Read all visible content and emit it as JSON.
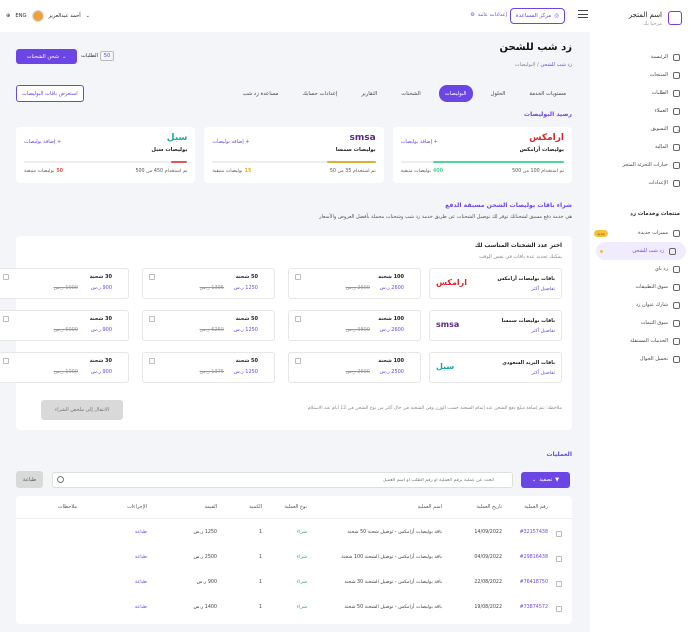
{
  "app": {
    "store_name": "اسم المتجر",
    "store_sub": "مرحبا بك",
    "help_label": "مركز المساعدة",
    "settings_label": "إعدادات عامة",
    "user_name": "أحمد عبدالعزيز",
    "lang": "ENG"
  },
  "sidebar": {
    "items": [
      {
        "label": "الرئيسية",
        "icon": "home-icon"
      },
      {
        "label": "المنتجات",
        "icon": "box-icon"
      },
      {
        "label": "الطلبات",
        "icon": "cart-icon"
      },
      {
        "label": "العملاء",
        "icon": "users-icon"
      },
      {
        "label": "التسويق",
        "icon": "megaphone-icon"
      },
      {
        "label": "المالية",
        "icon": "wallet-icon"
      },
      {
        "label": "خيارات التجزئة المتجر",
        "icon": "store-icon"
      },
      {
        "label": "الإعدادات",
        "icon": "gear-icon"
      }
    ],
    "group_title": "منتجات وخدمات زد",
    "sub_items": [
      {
        "label": "مميزات جديدة",
        "icon": "star-icon",
        "badge": "جديد"
      },
      {
        "label": "زد شب للشحن",
        "icon": "truck-icon",
        "active": true
      },
      {
        "label": "زد باي",
        "icon": "card-icon"
      },
      {
        "label": "سوق التطبيقات",
        "icon": "grid-icon"
      },
      {
        "label": "شارك عنوان زد",
        "icon": "share-icon"
      },
      {
        "label": "سوق الثيمات",
        "icon": "palette-icon"
      },
      {
        "label": "الخدمات المستقلة",
        "icon": "briefcase-icon"
      },
      {
        "label": "تحميل الجوال",
        "icon": "phone-icon"
      }
    ]
  },
  "header": {
    "title": "زد شب للشحن",
    "breadcrumb_root": "زد شب للشحن",
    "breadcrumb_current": "البوليصات",
    "ship_button": "شحن الشحنات",
    "orders_count_label": "الطلبات",
    "orders_count": "50"
  },
  "tabs": [
    "مستويات الخدمة",
    "الحلول",
    "البوليصات",
    "الشحنات",
    "التقارير",
    "إعدادات حسابك",
    "مساعدة زد شب"
  ],
  "out_button": "استعرض باقات البوليصات",
  "balance": {
    "title": "رصيد البوليصات",
    "cards": [
      {
        "brand": "ارامكس",
        "brand_color": "#d9262e",
        "name": "بوليصات أرامكس",
        "add": "+ إضافة بوليصات",
        "used_text": "تم استخدام 100 من 500",
        "remaining": "400",
        "remaining_label": "بوليصات متبقية",
        "fill": 0.8,
        "fill_color": "#4fd49a"
      },
      {
        "brand": "smsa",
        "brand_color": "#5a2a83",
        "name": "بوليصات سمسا",
        "add": "+ إضافة بوليصات",
        "used_text": "تم استخدام 35 من 50",
        "remaining": "15",
        "remaining_label": "بوليصات متبقية",
        "fill": 0.3,
        "fill_color": "#d6b430"
      },
      {
        "brand": "سبل",
        "brand_color": "#1aa6a6",
        "name": "بوليصات سبل",
        "add": "+ إضافة بوليصات",
        "used_text": "تم استخدام 450 من 500",
        "remaining": "50",
        "remaining_label": "بوليصات متبقية",
        "fill": 0.1,
        "fill_color": "#e05555"
      }
    ]
  },
  "prepaid": {
    "title": "شراء باقات بوليصات الشحن مسبقة الدفع",
    "desc": "هي خدمة دفع مسبق لشحناتك توفر لك توصيل الشحنات عن طريق خدمة زد شب وشحنات محملة بأفضل العروض والأسعار",
    "box_title": "اختر عدد الشحنات المناسب لك",
    "box_sub": "يمكنك تحديد عدة باقات في نفس الوقت",
    "more": "تفاصيل أكثر",
    "rows": [
      {
        "brand": "ارامكس",
        "brand_sub": "aramex",
        "brand_color": "#d9262e",
        "name": "باقات بوليصات أرامكس",
        "pkgs": [
          {
            "n": "100 شحنة",
            "p": "2600 ر.س",
            "o": "2600 ر.س"
          },
          {
            "n": "50 شحنة",
            "p": "1250 ر.س",
            "o": "1395 ر.س"
          },
          {
            "n": "30 شحنة",
            "p": "900 ر.س",
            "o": "1000 ر.س"
          }
        ]
      },
      {
        "brand": "smsa",
        "brand_sub": "EXPRESS",
        "brand_color": "#5a2a83",
        "name": "باقات بوليصات سمسا",
        "pkgs": [
          {
            "n": "100 شحنة",
            "p": "2600 ر.س",
            "o": "3800 ر.س"
          },
          {
            "n": "50 شحنة",
            "p": "1250 ر.س",
            "o": "6250 ر.س"
          },
          {
            "n": "30 شحنة",
            "p": "900 ر.س",
            "o": "6000 ر.س"
          }
        ]
      },
      {
        "brand": "سبل",
        "brand_sub": "SPL",
        "brand_color": "#1aa6a6",
        "name": "باقات البريد السعودي",
        "pkgs": [
          {
            "n": "100 شحنة",
            "p": "2500 ر.س",
            "o": "2600 ر.س"
          },
          {
            "n": "50 شحنة",
            "p": "1250 ر.س",
            "o": "1375 ر.س"
          },
          {
            "n": "30 شحنة",
            "p": "900 ر.س",
            "o": "1000 ر.س"
          }
        ]
      }
    ],
    "note": "ملاحظة: تتم إضافة مبلغ دفع الشحن عند إتمام الشحنة حسب الوزن وفي الشحنة في حال أكثر من نوع الشحن في 12 أيام عند الاستلام",
    "go_button": "الانتقال إلى ملخص الشراء"
  },
  "operations": {
    "title": "العمليات",
    "filter": "تصفية",
    "search_placeholder": "ابحث عن عملية برقم العملية أو رقم الطلب أو اسم العميل",
    "print": "طباعة",
    "headers": [
      "رقم العملية",
      "تاريخ العملية",
      "اسم العملية",
      "نوع العملية",
      "الكمية",
      "القيمة",
      "الإجراءات",
      "ملاحظات"
    ],
    "rows": [
      {
        "id": "#32157438",
        "date": "14/09/2022",
        "name": "باقة بوليصات أرامكس - توصيل شحنة 50 شحنة",
        "type": "شراء",
        "qty": "1",
        "val": "1250 ر.س",
        "act": "طباعة"
      },
      {
        "id": "#29816438",
        "date": "04/09/2022",
        "name": "باقة بوليصات أرامكس - توصيل الشحنة 100 شحنة",
        "type": "شراء",
        "qty": "1",
        "val": "2500 ر.س",
        "act": "طباعة"
      },
      {
        "id": "#76418750",
        "date": "22/08/2022",
        "name": "باقة بوليصات أرامكس - توصيل الشحنة 30 شحنة",
        "type": "شراء",
        "qty": "1",
        "val": "900 ر.س",
        "act": "طباعة"
      },
      {
        "id": "#73874572",
        "date": "19/08/2022",
        "name": "باقة بوليصات أرامكس - توصيل الشحنة 50 شحنة",
        "type": "شراء",
        "qty": "1",
        "val": "1400 ر.س",
        "act": "طباعة"
      }
    ]
  }
}
